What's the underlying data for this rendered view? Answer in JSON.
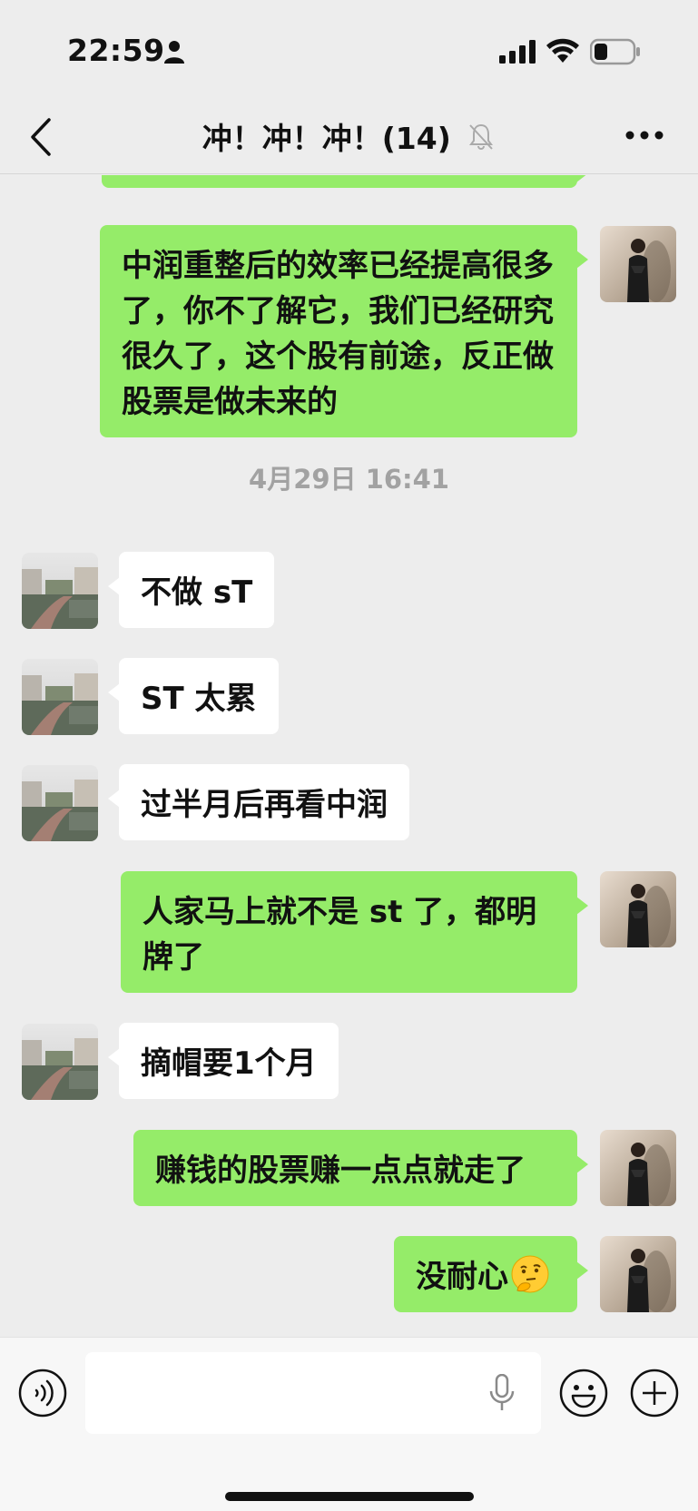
{
  "status_bar": {
    "time": "22:59",
    "person_icon": "person-fill-icon",
    "signal_icon": "cellular-signal-icon",
    "wifi_icon": "wifi-icon",
    "battery_icon": "battery-low-icon",
    "battery_level": 0.3
  },
  "nav": {
    "back_icon": "chevron-left-icon",
    "title": "冲！冲！冲！(14)",
    "mute_icon": "bell-slash-icon",
    "more_icon": "ellipsis-icon"
  },
  "messages": [
    {
      "sender": "me",
      "text": ""
    },
    {
      "sender": "me",
      "text": "中润重整后的效率已经提高很多了，你不了解它，我们已经研究很久了，这个股有前途，反正做股票是做未来的"
    },
    {
      "type": "timestamp",
      "text": "4月29日 16:41"
    },
    {
      "sender": "other",
      "text": "不做 sT"
    },
    {
      "sender": "other",
      "text": "ST 太累"
    },
    {
      "sender": "other",
      "text": "过半月后再看中润"
    },
    {
      "sender": "me",
      "text": "人家马上就不是 st 了，都明牌了"
    },
    {
      "sender": "other",
      "text": "摘帽要1个月"
    },
    {
      "sender": "me",
      "text": "赚钱的股票赚一点点就走了"
    },
    {
      "sender": "me",
      "text": "没耐心",
      "emoji": "thinking-face-emoji"
    }
  ],
  "input_bar": {
    "voice_icon": "voice-mode-icon",
    "placeholder": "",
    "mic_icon": "microphone-icon",
    "emoji_icon": "smiley-icon",
    "plus_icon": "plus-circle-icon"
  },
  "colors": {
    "my_bubble": "#95ec69",
    "other_bubble": "#ffffff",
    "background": "#ededed"
  }
}
